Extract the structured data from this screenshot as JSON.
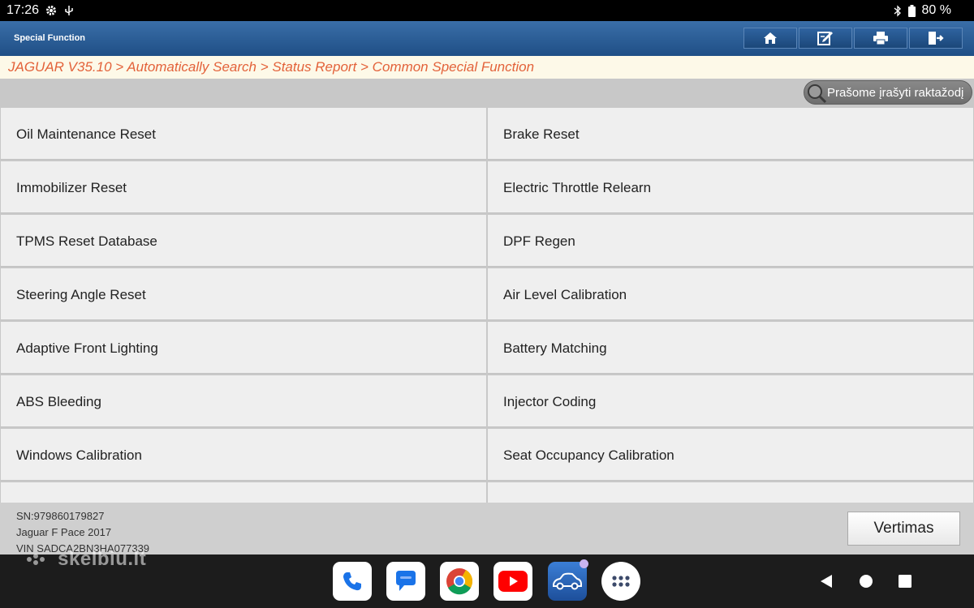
{
  "status_bar": {
    "time": "17:26",
    "battery": "80 %"
  },
  "title_bar": {
    "title": "Special Function",
    "buttons": [
      "home-icon",
      "edit-icon",
      "print-icon",
      "exit-icon"
    ]
  },
  "breadcrumb": "JAGUAR V35.10 > Automatically Search > Status Report > Common Special Function",
  "search": {
    "placeholder": "Prašome įrašyti raktažodį"
  },
  "functions": [
    [
      "Oil Maintenance Reset",
      "Brake Reset"
    ],
    [
      "Immobilizer Reset",
      "Electric Throttle Relearn"
    ],
    [
      "TPMS Reset Database",
      "DPF Regen"
    ],
    [
      "Steering Angle Reset",
      "Air Level Calibration"
    ],
    [
      "Adaptive Front Lighting",
      "Battery Matching"
    ],
    [
      "ABS Bleeding",
      "Injector Coding"
    ],
    [
      "Windows Calibration",
      "Seat Occupancy Calibration"
    ],
    [
      "",
      ""
    ]
  ],
  "footer": {
    "sn": "SN:979860179827",
    "vehicle": "Jaguar F Pace 2017",
    "vin": "VIN SADCA2BN3HA077339",
    "translate_label": "Vertimas"
  },
  "watermark": "skelbiu.lt",
  "dock": [
    "phone-icon",
    "messages-icon",
    "chrome-icon",
    "youtube-icon",
    "car-diagnostic-app-icon",
    "app-drawer-icon"
  ],
  "colors": {
    "title_bar": "#2a5b93",
    "breadcrumb_text": "#e3623a",
    "breadcrumb_bg": "#fdf9e8",
    "cell_bg": "#efefef"
  }
}
